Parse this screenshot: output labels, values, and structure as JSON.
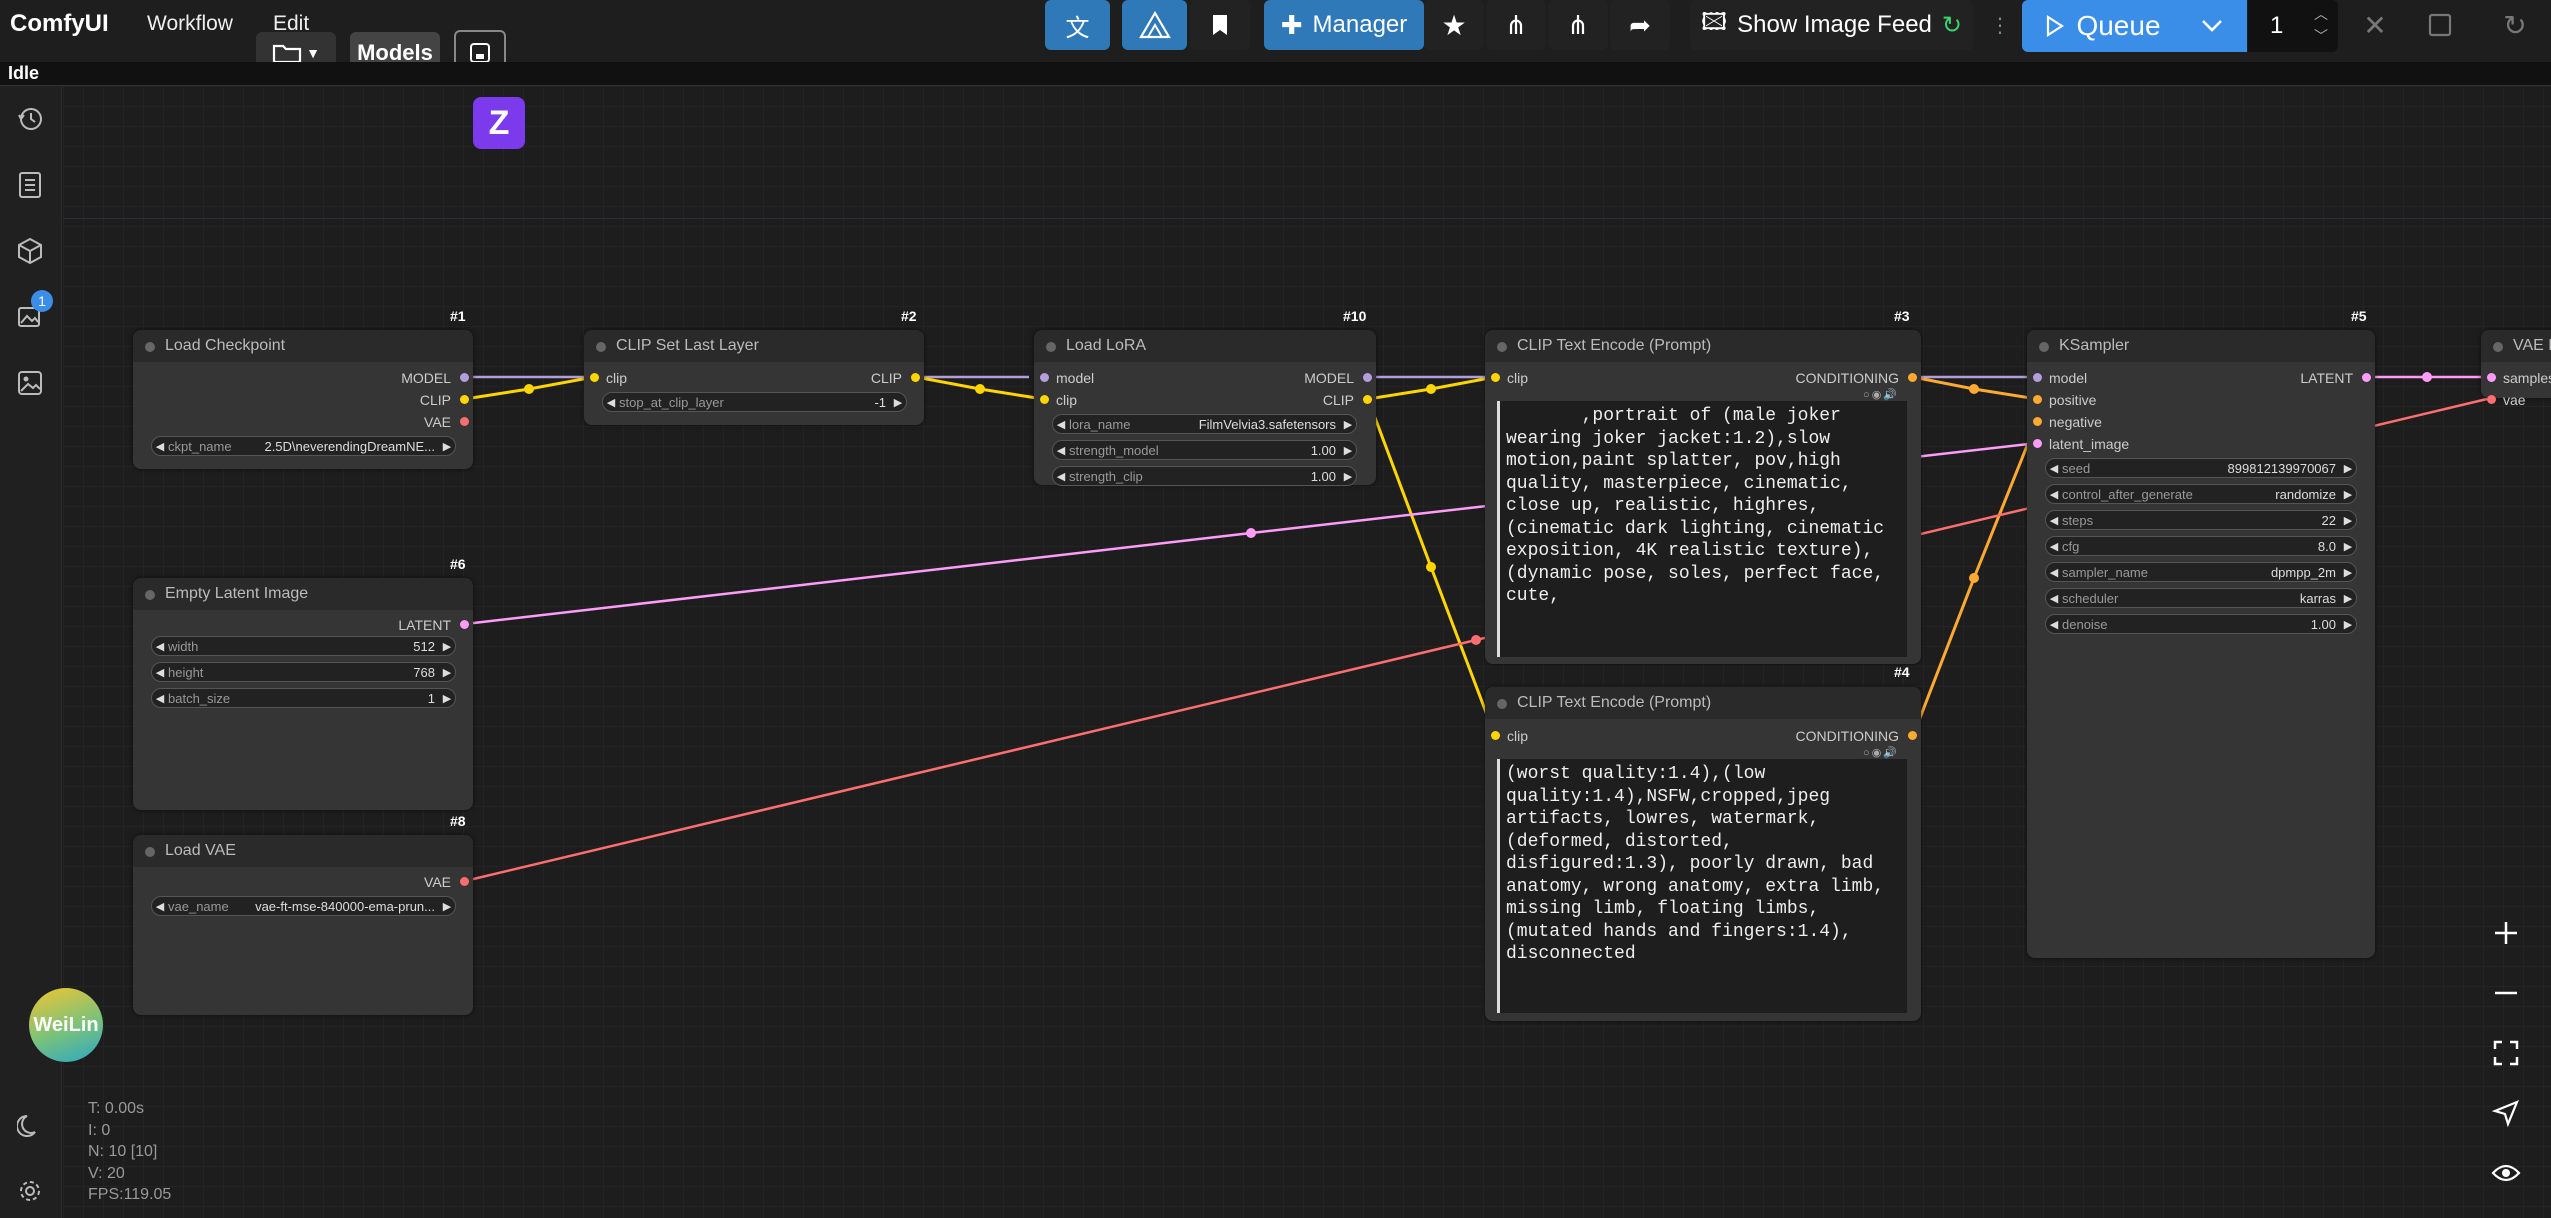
{
  "app": {
    "brand": "ComfyUI",
    "menu": [
      "Workflow",
      "Edit"
    ],
    "models_label": "Models",
    "status": "Idle"
  },
  "toolbar": {
    "manager_label": "Manager",
    "image_feed_label": "Show Image Feed",
    "queue_label": "Queue",
    "queue_count": "1"
  },
  "sidebar": {
    "queue_badge": "1",
    "weilin_label": "WeiLin"
  },
  "stats": {
    "lines": [
      "T: 0.00s",
      "I: 0",
      "N: 10 [10]",
      "V: 20",
      "FPS:119.05"
    ]
  },
  "nodes": {
    "load_checkpoint": {
      "id": "#1",
      "title": "Load Checkpoint",
      "outputs": [
        "MODEL",
        "CLIP",
        "VAE"
      ],
      "widgets": [
        {
          "label": "ckpt_name",
          "value": "2.5D\\neverendingDreamNE..."
        }
      ]
    },
    "clip_set_last_layer": {
      "id": "#2",
      "title": "CLIP Set Last Layer",
      "inputs": [
        "clip"
      ],
      "outputs": [
        "CLIP"
      ],
      "widgets": [
        {
          "label": "stop_at_clip_layer",
          "value": "-1"
        }
      ]
    },
    "load_lora": {
      "id": "#10",
      "title": "Load LoRA",
      "inputs": [
        "model",
        "clip"
      ],
      "outputs": [
        "MODEL",
        "CLIP"
      ],
      "widgets": [
        {
          "label": "lora_name",
          "value": "FilmVelvia3.safetensors"
        },
        {
          "label": "strength_model",
          "value": "1.00"
        },
        {
          "label": "strength_clip",
          "value": "1.00"
        }
      ]
    },
    "clip_text_positive": {
      "id": "#3",
      "title": "CLIP Text Encode (Prompt)",
      "inputs": [
        "clip"
      ],
      "outputs": [
        "CONDITIONING"
      ],
      "text": "       ,portrait of (male joker wearing joker jacket:1.2),slow motion,paint splatter, pov,high quality, masterpiece, cinematic, close up, realistic, highres, (cinematic dark lighting, cinematic exposition, 4K realistic texture),(dynamic pose, soles, perfect face, cute,"
    },
    "clip_text_negative": {
      "id": "#4",
      "title": "CLIP Text Encode (Prompt)",
      "inputs": [
        "clip"
      ],
      "outputs": [
        "CONDITIONING"
      ],
      "text": "(worst quality:1.4),(low quality:1.4),NSFW,cropped,jpeg artifacts, lowres, watermark, (deformed, distorted, disfigured:1.3), poorly drawn, bad anatomy, wrong anatomy, extra limb, missing limb, floating limbs, (mutated hands and fingers:1.4), disconnected"
    },
    "ksampler": {
      "id": "#5",
      "title": "KSampler",
      "inputs": [
        "model",
        "positive",
        "negative",
        "latent_image"
      ],
      "outputs": [
        "LATENT"
      ],
      "widgets": [
        {
          "label": "seed",
          "value": "899812139970067"
        },
        {
          "label": "control_after_generate",
          "value": "randomize"
        },
        {
          "label": "steps",
          "value": "22"
        },
        {
          "label": "cfg",
          "value": "8.0"
        },
        {
          "label": "sampler_name",
          "value": "dpmpp_2m"
        },
        {
          "label": "scheduler",
          "value": "karras"
        },
        {
          "label": "denoise",
          "value": "1.00"
        }
      ]
    },
    "empty_latent": {
      "id": "#6",
      "title": "Empty Latent Image",
      "outputs": [
        "LATENT"
      ],
      "widgets": [
        {
          "label": "width",
          "value": "512"
        },
        {
          "label": "height",
          "value": "768"
        },
        {
          "label": "batch_size",
          "value": "1"
        }
      ]
    },
    "load_vae": {
      "id": "#8",
      "title": "Load VAE",
      "outputs": [
        "VAE"
      ],
      "widgets": [
        {
          "label": "vae_name",
          "value": "vae-ft-mse-840000-ema-prun..."
        }
      ]
    },
    "vae_decode": {
      "title": "VAE D",
      "inputs": [
        "samples",
        "vae"
      ]
    }
  },
  "colors": {
    "model": "#b39ddb",
    "clip": "#ffd500",
    "vae": "#ff6e6e",
    "latent": "#ff9cf9",
    "conditioning": "#ffa931",
    "accent_blue": "#2f79b9",
    "queue_blue": "#3b8ee8"
  }
}
